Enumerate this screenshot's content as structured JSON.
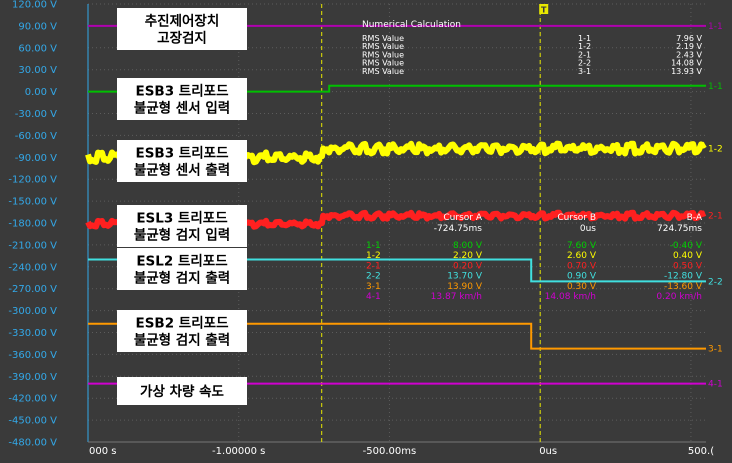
{
  "chart_data": {
    "type": "line",
    "title": "",
    "xlabel": "",
    "ylabel": "",
    "y_unit": "V",
    "ylim": [
      -480,
      120
    ],
    "y_ticks": [
      "120.00 V",
      "90.00 V",
      "60.00 V",
      "30.00 V",
      "0.00 V",
      "-30.00 V",
      "-60.00 V",
      "-90.00 V",
      "-120.00 V",
      "-150.00 V",
      "-180.00 V",
      "-210.00 V",
      "-240.00 V",
      "-270.00 V",
      "-300.00 V",
      "-330.00 V",
      "-360.00 V",
      "-390.00 V",
      "-420.00 V",
      "-450.00 V",
      "-480.00 V"
    ],
    "y_tick_values": [
      120,
      90,
      60,
      30,
      0,
      -30,
      -60,
      -90,
      -120,
      -150,
      -180,
      -210,
      -240,
      -270,
      -300,
      -330,
      -360,
      -390,
      -420,
      -450,
      -480
    ],
    "xlim_s": [
      -1.5,
      0.55
    ],
    "x_tick_labels": [
      {
        "x": -1.5,
        "label": "000 s"
      },
      {
        "x": -1.0,
        "label": "-1.00000 s"
      },
      {
        "x": -0.5,
        "label": "-500.00ms"
      },
      {
        "x": 0.0,
        "label": "0us"
      },
      {
        "x": 0.5,
        "label": "500.("
      }
    ],
    "cursor_a_x": -0.72475,
    "cursor_b_x": 0.0,
    "trigger_marker": "T",
    "series": [
      {
        "id": "1-1",
        "color": "#b000b0",
        "end_label": "1-1",
        "points": [
          [
            -1.5,
            90
          ],
          [
            0,
            90
          ],
          [
            0,
            90
          ],
          [
            0.55,
            90
          ]
        ]
      },
      {
        "id": "2-1",
        "color": "#00c000",
        "end_label": "1-1",
        "points": [
          [
            -1.5,
            0
          ],
          [
            -0.7,
            0
          ],
          [
            -0.7,
            8
          ],
          [
            0.55,
            8
          ]
        ]
      },
      {
        "id": "1-2",
        "color": "#ffff00",
        "end_label": "1-2",
        "noise": 5,
        "points": [
          [
            -1.5,
            -90
          ],
          [
            -0.72,
            -90
          ],
          [
            -0.72,
            -78
          ],
          [
            0.55,
            -78
          ]
        ]
      },
      {
        "id": "2-2",
        "color": "#ff2020",
        "end_label": "2-1",
        "noise": 3,
        "points": [
          [
            -1.5,
            -181
          ],
          [
            -0.72,
            -181
          ],
          [
            -0.72,
            -170
          ],
          [
            0.55,
            -170
          ]
        ]
      },
      {
        "id": "3-1",
        "color": "#40e0e0",
        "end_label": "2-2",
        "points": [
          [
            -1.5,
            -230
          ],
          [
            -0.03,
            -230
          ],
          [
            -0.03,
            -260
          ],
          [
            0.55,
            -260
          ]
        ]
      },
      {
        "id": "4-1",
        "color": "#ff9900",
        "end_label": "3-1",
        "points": [
          [
            -1.5,
            -318
          ],
          [
            -0.03,
            -318
          ],
          [
            -0.03,
            -352
          ],
          [
            0.55,
            -352
          ]
        ]
      },
      {
        "id": "5-1",
        "color": "#d000d0",
        "end_label": "4-1",
        "points": [
          [
            -1.5,
            -400
          ],
          [
            0.55,
            -400
          ]
        ]
      }
    ],
    "annotations": [
      {
        "id": "ann1",
        "lines": [
          "추진제어장치",
          "고장검지"
        ]
      },
      {
        "id": "ann2",
        "lines": [
          "ESB3 트리포드",
          "불균형 센서 입력"
        ]
      },
      {
        "id": "ann3",
        "lines": [
          "ESB3 트리포드",
          "불균형 센서 출력"
        ]
      },
      {
        "id": "ann4",
        "lines": [
          "ESL3 트리포드",
          "불균형 검지 입력"
        ]
      },
      {
        "id": "ann5",
        "lines": [
          "ESL2 트리포드",
          "불균형 검지 출력"
        ]
      },
      {
        "id": "ann6",
        "lines": [
          "ESB2 트리포드",
          "불균형 검지 출력"
        ]
      },
      {
        "id": "ann7",
        "lines": [
          "가상 차량 속도"
        ]
      }
    ],
    "numerical_calculation": {
      "title": "Numerical Calculation",
      "rows": [
        {
          "label": "RMS Value",
          "ch": "1-1",
          "value": "7.96 V"
        },
        {
          "label": "RMS Value",
          "ch": "1-2",
          "value": "2.19 V"
        },
        {
          "label": "RMS Value",
          "ch": "2-1",
          "value": "2.43 V"
        },
        {
          "label": "RMS Value",
          "ch": "2-2",
          "value": "14.08 V"
        },
        {
          "label": "RMS Value",
          "ch": "3-1",
          "value": "13.93 V"
        }
      ]
    },
    "cursor_table": {
      "headers": [
        "Cursor A",
        "Cursor B",
        "B-A"
      ],
      "times": [
        "-724.75ms",
        "0us",
        "724.75ms"
      ],
      "rows": [
        {
          "ch": "1-1",
          "a": "8.00 V",
          "b": "7.60 V",
          "d": "-0.40 V",
          "color": "#00d000"
        },
        {
          "ch": "1-2",
          "a": "2.20 V",
          "b": "2.60 V",
          "d": "0.40 V",
          "color": "#ffff00"
        },
        {
          "ch": "2-1",
          "a": "0.20 V",
          "b": "0.70 V",
          "d": "0.50 V",
          "color": "#ff2020"
        },
        {
          "ch": "2-2",
          "a": "13.70 V",
          "b": "0.90 V",
          "d": "-12.80 V",
          "color": "#40e0e0"
        },
        {
          "ch": "3-1",
          "a": "13.90 V",
          "b": "0.30 V",
          "d": "-13.60 V",
          "color": "#ff9900"
        },
        {
          "ch": "4-1",
          "a": "13.87 km/h",
          "b": "14.08 km/h",
          "d": "0.20 km/h",
          "color": "#d000d0"
        }
      ]
    }
  }
}
